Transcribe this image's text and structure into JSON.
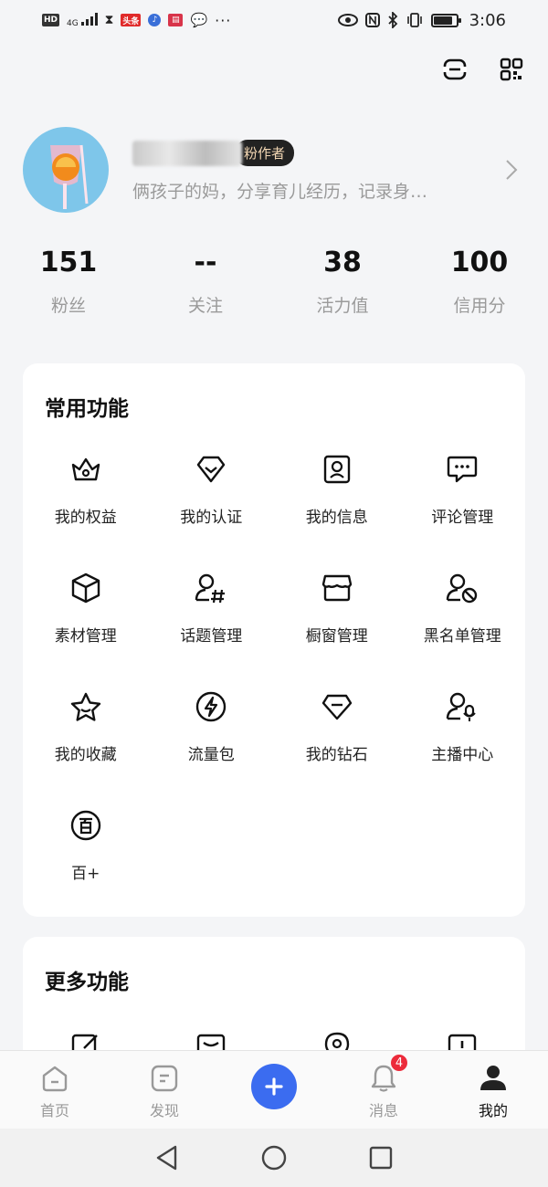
{
  "status_bar": {
    "chips": [
      "HD",
      "4G",
      "头条"
    ],
    "time": "3:06",
    "battery_level": 0.85
  },
  "top_icons": [
    "scan-icon",
    "qr-code-icon"
  ],
  "profile": {
    "badge": "粉作者",
    "bio": "俩孩子的妈，分享育儿经历，记录身…"
  },
  "stats": [
    {
      "value": "151",
      "label": "粉丝"
    },
    {
      "value": "--",
      "label": "关注"
    },
    {
      "value": "38",
      "label": "活力值"
    },
    {
      "value": "100",
      "label": "信用分"
    }
  ],
  "common": {
    "title": "常用功能",
    "items": [
      {
        "label": "我的权益",
        "icon": "crown-icon"
      },
      {
        "label": "我的认证",
        "icon": "verify-icon"
      },
      {
        "label": "我的信息",
        "icon": "profile-card-icon"
      },
      {
        "label": "评论管理",
        "icon": "comment-icon"
      },
      {
        "label": "素材管理",
        "icon": "cube-icon"
      },
      {
        "label": "话题管理",
        "icon": "topic-icon"
      },
      {
        "label": "橱窗管理",
        "icon": "shop-icon"
      },
      {
        "label": "黑名单管理",
        "icon": "blocklist-icon"
      },
      {
        "label": "我的收藏",
        "icon": "star-icon"
      },
      {
        "label": "流量包",
        "icon": "lightning-icon"
      },
      {
        "label": "我的钻石",
        "icon": "diamond-icon"
      },
      {
        "label": "主播中心",
        "icon": "anchor-icon"
      },
      {
        "label": "百+",
        "icon": "bai-plus-icon"
      }
    ]
  },
  "more": {
    "title": "更多功能"
  },
  "bottom_nav": [
    {
      "label": "首页",
      "icon": "home-icon"
    },
    {
      "label": "发现",
      "icon": "discover-icon"
    },
    {
      "label": "",
      "icon": "publish-plus-icon"
    },
    {
      "label": "消息",
      "icon": "bell-icon",
      "badge": "4"
    },
    {
      "label": "我的",
      "icon": "me-icon",
      "active": true
    }
  ]
}
